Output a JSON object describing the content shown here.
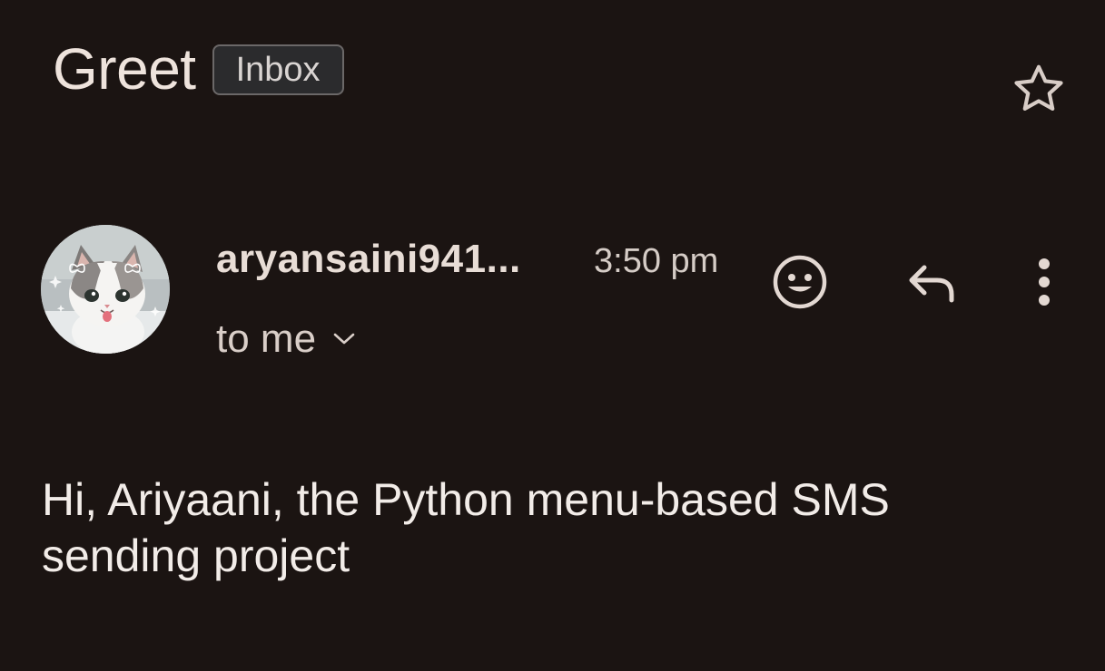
{
  "email": {
    "subject": "Greet",
    "label": "Inbox",
    "sender": "aryansaini941...",
    "time": "3:50 pm",
    "recipients": "to me",
    "body": "Hi, Ariyaani, the Python menu-based SMS sending project"
  },
  "icons": {
    "star": "star-outline-icon",
    "avatar": "cat-avatar",
    "expand": "chevron-down-icon",
    "react": "emoji-smile-icon",
    "reply": "reply-arrow-icon",
    "more": "more-vertical-icon"
  },
  "colors": {
    "background": "#1b1412",
    "text": "#e8ddd6",
    "chip_background": "#2b2b2d",
    "chip_border": "#6b6868"
  }
}
